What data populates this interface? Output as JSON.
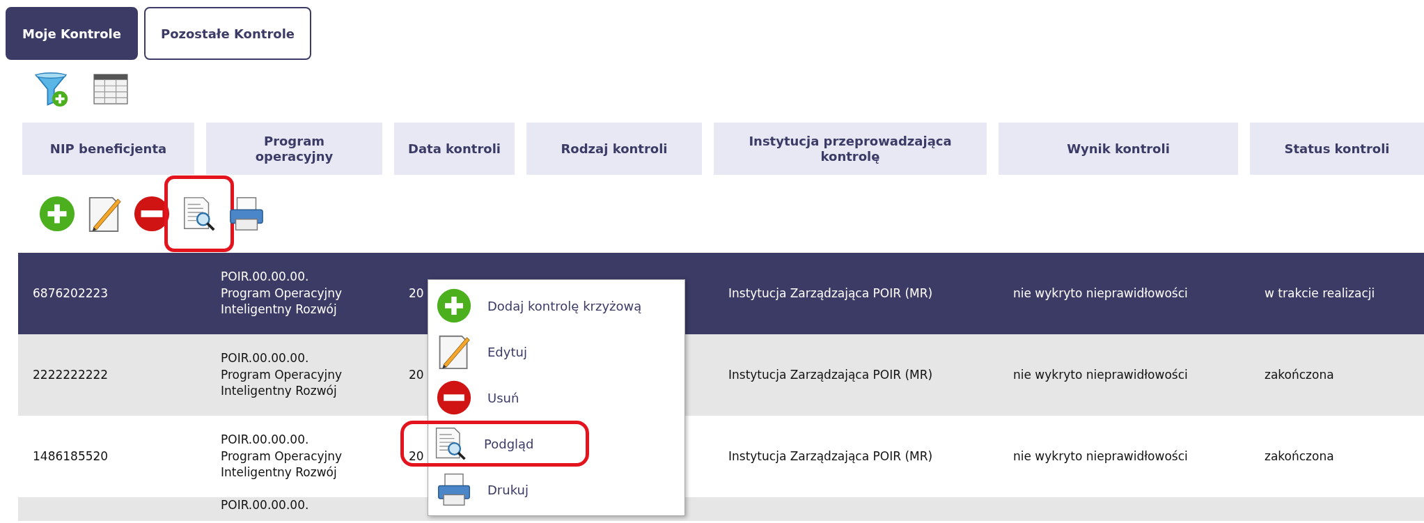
{
  "tabs": [
    {
      "label": "Moje Kontrole",
      "selected": true
    },
    {
      "label": "Pozostałe Kontrole",
      "selected": false
    }
  ],
  "view_tools": [
    {
      "kind": "filter"
    },
    {
      "kind": "table"
    }
  ],
  "table": {
    "columns": [
      "NIP beneficjenta",
      "Program operacyjny",
      "Data kontroli",
      "Rodzaj kontroli",
      "Instytucja przeprowadzająca kontrolę",
      "Wynik kontroli",
      "Status kontroli"
    ],
    "actions": [
      {
        "kind": "add",
        "highlighted": false
      },
      {
        "kind": "edit",
        "highlighted": false
      },
      {
        "kind": "delete",
        "highlighted": false
      },
      {
        "kind": "preview",
        "highlighted": true
      },
      {
        "kind": "print",
        "highlighted": false
      }
    ],
    "rows": [
      {
        "selected": true,
        "cells": [
          "6876202223",
          "POIR.00.00.00. Program Operacyjny Inteligentny Rozwój",
          "20",
          "",
          "Instytucja Zarządzająca POIR (MR)",
          "nie wykryto nieprawidłowości",
          "w trakcie realizacji"
        ]
      },
      {
        "selected": false,
        "cells": [
          "2222222222",
          "POIR.00.00.00. Program Operacyjny Inteligentny Rozwój",
          "20",
          "",
          "Instytucja Zarządzająca POIR (MR)",
          "nie wykryto nieprawidłowości",
          "zakończona"
        ]
      },
      {
        "selected": false,
        "cells": [
          "1486185520",
          "POIR.00.00.00. Program Operacyjny Inteligentny Rozwój",
          "20",
          "",
          "Instytucja Zarządzająca POIR (MR)",
          "nie wykryto nieprawidłowości",
          "zakończona"
        ]
      },
      {
        "selected": false,
        "cells": [
          "",
          "POIR.00.00.00.",
          "",
          "",
          "",
          "",
          ""
        ]
      }
    ]
  },
  "context_menu": {
    "items": [
      {
        "kind": "add",
        "label": "Dodaj kontrolę krzyżową",
        "highlighted": false
      },
      {
        "kind": "edit",
        "label": "Edytuj",
        "highlighted": false
      },
      {
        "kind": "delete",
        "label": "Usuń",
        "highlighted": false
      },
      {
        "kind": "preview",
        "label": "Podgląd",
        "highlighted": true
      },
      {
        "kind": "print",
        "label": "Drukuj",
        "highlighted": false
      }
    ]
  }
}
